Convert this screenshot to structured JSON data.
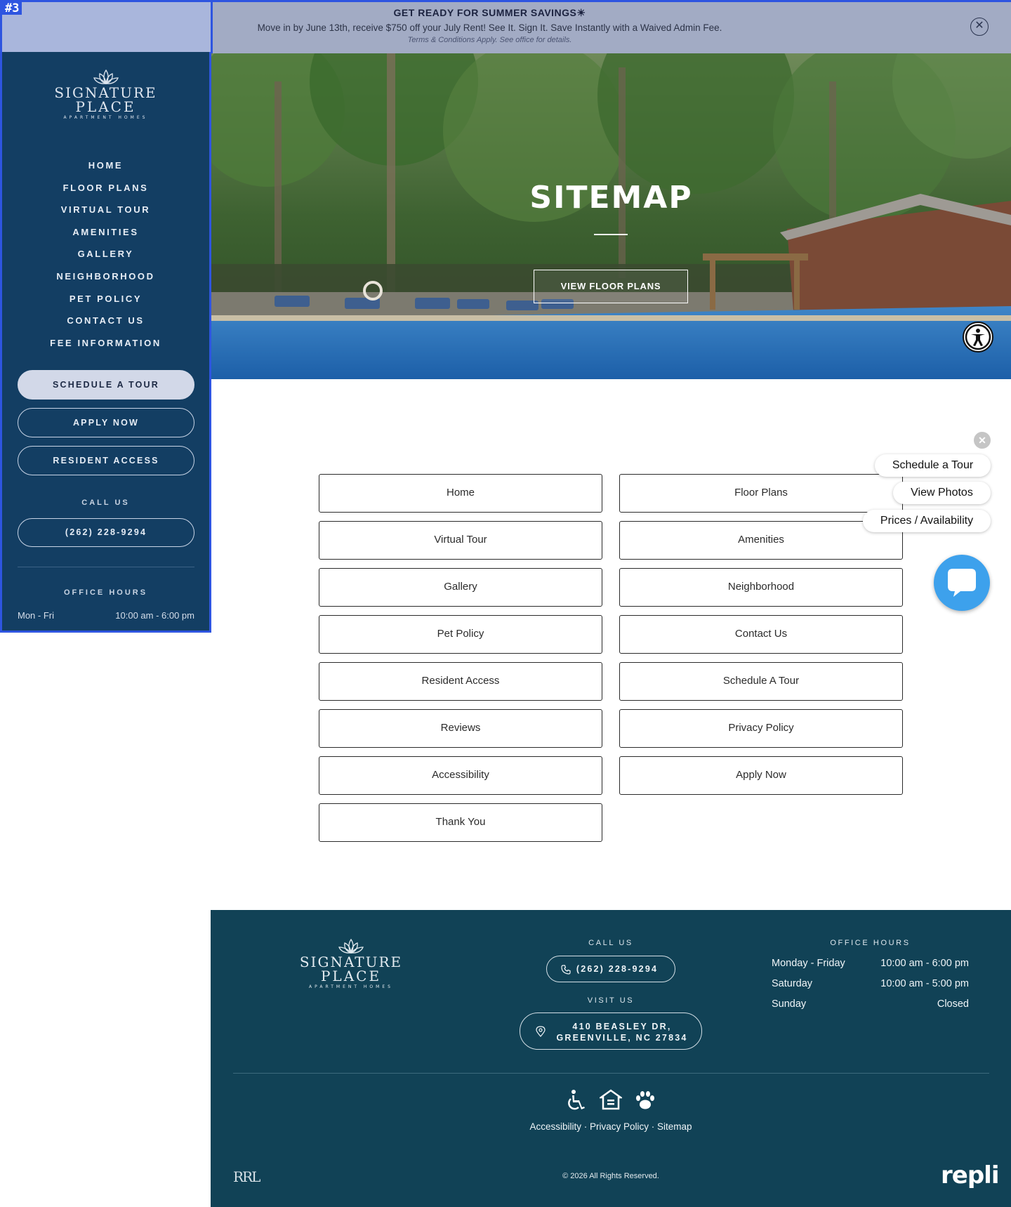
{
  "banner": {
    "tag": "#3",
    "title": "GET READY FOR SUMMER SAVINGS☀",
    "text": "Move in by June 13th, receive $750 off your July Rent! See It. Sign It. Save Instantly with a Waived Admin Fee.",
    "terms": "Terms & Conditions Apply. See office for details.",
    "close_icon": "✕"
  },
  "brand": {
    "line1": "SIGNATURE",
    "line2": "PLACE",
    "line3": "APARTMENT HOMES"
  },
  "sidebar": {
    "nav": [
      "HOME",
      "FLOOR PLANS",
      "VIRTUAL TOUR",
      "AMENITIES",
      "GALLERY",
      "NEIGHBORHOOD",
      "PET POLICY",
      "CONTACT US",
      "FEE INFORMATION"
    ],
    "schedule_tour": "SCHEDULE A TOUR",
    "apply_now": "APPLY NOW",
    "resident_access": "RESIDENT ACCESS",
    "call_label": "CALL US",
    "phone": "(262) 228-9294",
    "hours_label": "OFFICE HOURS",
    "hours_days": "Mon - Fri",
    "hours_time": "10:00 am - 6:00 pm"
  },
  "hero": {
    "title": "SITEMAP",
    "button": "VIEW FLOOR PLANS"
  },
  "sitemap": {
    "links": [
      "Home",
      "Floor Plans",
      "Virtual Tour",
      "Amenities",
      "Gallery",
      "Neighborhood",
      "Pet Policy",
      "Contact Us",
      "Resident Access",
      "Schedule A Tour",
      "Reviews",
      "Privacy Policy",
      "Accessibility",
      "Apply Now",
      "Thank You"
    ]
  },
  "widget": {
    "schedule": "Schedule a Tour",
    "photos": "View Photos",
    "prices": "Prices / Availability",
    "close": "✕"
  },
  "footer": {
    "call_label": "CALL US",
    "phone": "(262) 228-9294",
    "visit_label": "VISIT US",
    "address_line1": "410 BEASLEY DR,",
    "address_line2": "GREENVILLE, NC 27834",
    "hours_label": "OFFICE HOURS",
    "hours": [
      {
        "day": "Monday - Friday",
        "time": "10:00 am - 6:00 pm"
      },
      {
        "day": "Saturday",
        "time": "10:00 am - 5:00 pm"
      },
      {
        "day": "Sunday",
        "time": "Closed"
      }
    ],
    "links": [
      "Accessibility",
      "Privacy Policy",
      "Sitemap"
    ],
    "separator": " · ",
    "copyright": "© 2026 All Rights Reserved.",
    "rrl": "RRL",
    "repli": "repli"
  },
  "colors": {
    "sidebar_bg": "#133e63",
    "footer_bg": "#114256",
    "highlight_border": "#2e55e0",
    "chat_blue": "#3da1ec"
  }
}
